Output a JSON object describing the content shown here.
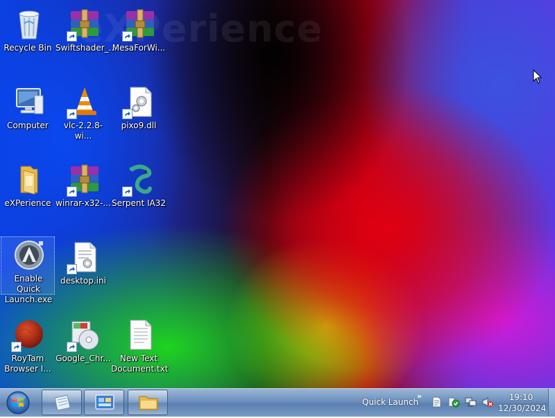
{
  "desktop": {
    "watermark": "eXPerience",
    "icons": [
      {
        "label": "Recycle Bin"
      },
      {
        "label": "Swiftshader_..."
      },
      {
        "label": "MesaForWi..."
      },
      {
        "label": "Computer"
      },
      {
        "label": "vlc-2.2.8-wi..."
      },
      {
        "label": "pixo9.dll"
      },
      {
        "label": "eXPerience"
      },
      {
        "label": "winrar-x32-..."
      },
      {
        "label": "Serpent IA32"
      },
      {
        "label": "Enable Quick Launch.exe"
      },
      {
        "label": "desktop.ini"
      },
      {
        "label": "RoyTam Browser I..."
      },
      {
        "label": "Google_Chr..."
      },
      {
        "label": "New Text Document.txt"
      }
    ]
  },
  "taskbar": {
    "quick_launch_label": "Quick Launch",
    "chevron": "»",
    "clock": {
      "time": "19:10",
      "date": "12/30/2024"
    }
  },
  "colors": {
    "taskbar": "#6c90bd",
    "label_text": "#ffffff"
  }
}
